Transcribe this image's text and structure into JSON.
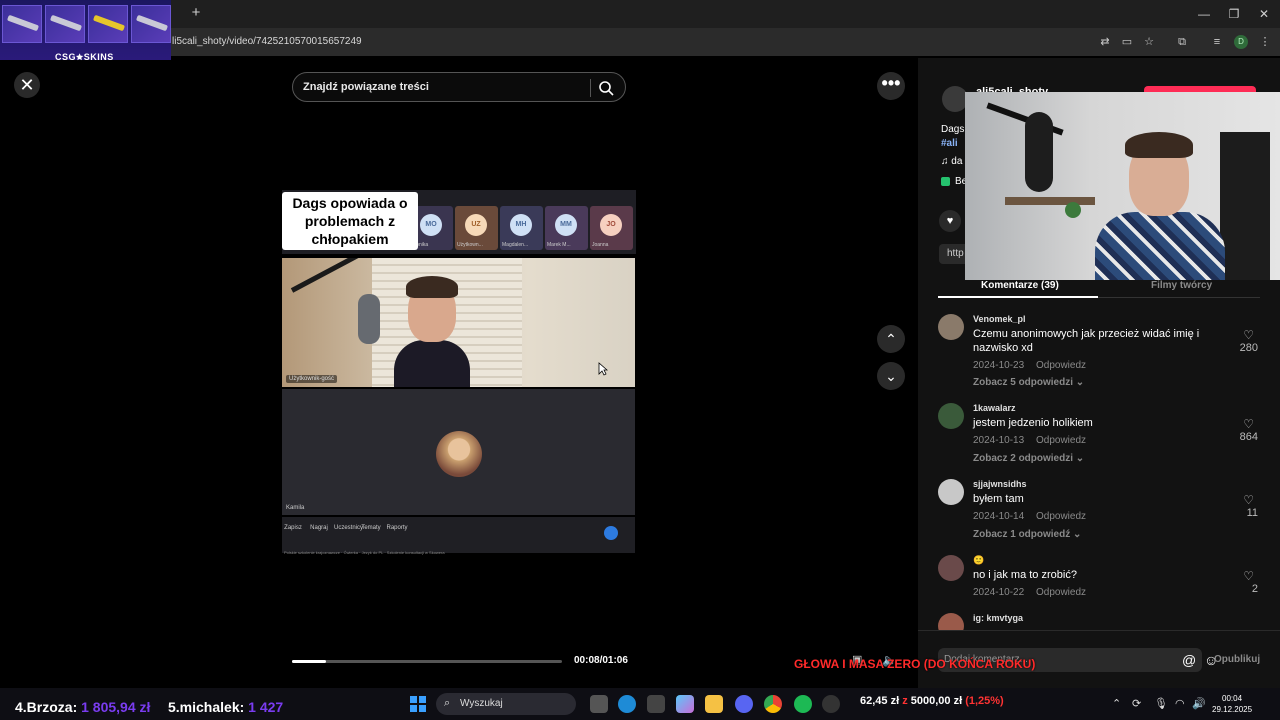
{
  "browser": {
    "url": "li5cali_shoty/video/7425210570015657249",
    "new_tab": "+",
    "profile_initial": "D",
    "window_controls": {
      "minimize": "—",
      "restore": "❐",
      "close": "✕"
    }
  },
  "overlay_csgo": {
    "brand": "CSG🟊SKINS"
  },
  "video": {
    "close_label": "✕",
    "search_placeholder": "Znajdź powiązane treści",
    "caption": "Dags opowiada o problemach z chłopakiem",
    "meet_thumbs": [
      {
        "initials": "MO",
        "name": "Monika"
      },
      {
        "initials": "UZ",
        "name": "Użytkown..."
      },
      {
        "initials": "MH",
        "name": "Magdalen..."
      },
      {
        "initials": "MM",
        "name": "Marek M..."
      },
      {
        "initials": "JO",
        "name": "Joanna"
      }
    ],
    "cam_label": "Użytkownik-gość",
    "participant_label": "Kamila",
    "toolbar": [
      "Zapisz",
      "Nagraj",
      "Uczestnicy",
      "Tematy",
      "Raporty"
    ],
    "breadcrumb": "Polskie szkolenie krajoznawcze · Ćwierka · Jezyk do PL · Szkolenie konsultacji w Skowera",
    "time": "00:08/01:06",
    "progress_fraction": 0.126
  },
  "controls": {
    "more": "•••",
    "up": "⌃",
    "down": "⌄"
  },
  "panel": {
    "author": "ali5cali_shoty",
    "desc_line": "Dags",
    "hashtag": "#ali",
    "music": "♫  da",
    "badge": "Be",
    "link_text": "http",
    "tabs": {
      "comments": "Komentarze (39)",
      "creator": "Filmy twórcy"
    },
    "comments": [
      {
        "user": "Venomek_pl",
        "text": "Czemu anonimowych jak przecież widać imię i nazwisko xd",
        "date": "2024-10-23",
        "reply": "Odpowiedz",
        "more": "Zobacz 5 odpowiedzi ⌄",
        "likes": "280"
      },
      {
        "user": "1kawalarz",
        "text": "jestem jedzenio holikiem",
        "date": "2024-10-13",
        "reply": "Odpowiedz",
        "more": "Zobacz 2 odpowiedzi ⌄",
        "likes": "864"
      },
      {
        "user": "sjjajwnsidhs",
        "text": "byłem tam",
        "date": "2024-10-14",
        "reply": "Odpowiedz",
        "more": "Zobacz 1 odpowiedź ⌄",
        "likes": "11"
      },
      {
        "user": "🙂",
        "text": "no i jak ma to zrobić?",
        "date": "2024-10-22",
        "reply": "Odpowiedz",
        "more": "",
        "likes": "2"
      },
      {
        "user": "ig: kmvtyga",
        "text": "",
        "date": "",
        "reply": "",
        "more": "",
        "likes": ""
      }
    ],
    "comment_placeholder": "Dodaj komentarz...",
    "publish": "Opublikuj"
  },
  "stream_overlay": {
    "red_text": "GŁOWA I MASA ZERO (DO KOŃCA ROKU)"
  },
  "taskbar": {
    "leader4": {
      "name": "4.Brzoza:",
      "amount": "1 805,94 zł"
    },
    "leader5": {
      "name": "5.michalek:",
      "amount": "1 427"
    },
    "search": "Wyszukaj",
    "stats_left": "62,45 zł",
    "stats_sep": " z ",
    "stats_goal": "5000,00 zł",
    "stats_pct": "(1,25%)",
    "time": "00:04",
    "date": "29.12.2025"
  }
}
